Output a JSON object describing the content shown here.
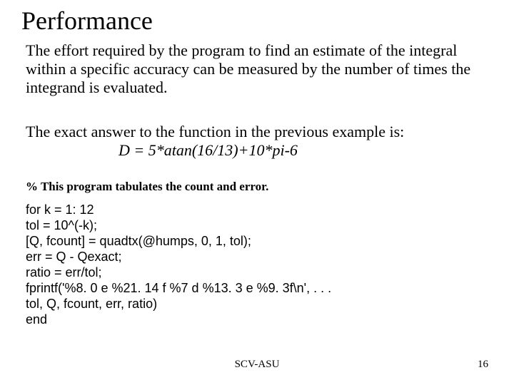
{
  "title": "Performance",
  "para1": "The effort required by the program to find an estimate of the integral within a specific accuracy can be measured by the number of times the integrand is evaluated.",
  "para2_line1": "The exact answer to the function in the previous example is:",
  "formula": "D = 5*atan(16/13)+10*pi-6",
  "comment": "% This program tabulates the count and error.",
  "code": "for k = 1: 12\ntol = 10^(-k);\n[Q, fcount] = quadtx(@humps, 0, 1, tol);\nerr = Q - Qexact;\nratio = err/tol;\nfprintf('%8. 0 e %21. 14 f %7 d %13. 3 e %9. 3f\\n', . . .\ntol, Q, fcount, err, ratio)\nend",
  "footer_center": "SCV-ASU",
  "footer_right": "16"
}
